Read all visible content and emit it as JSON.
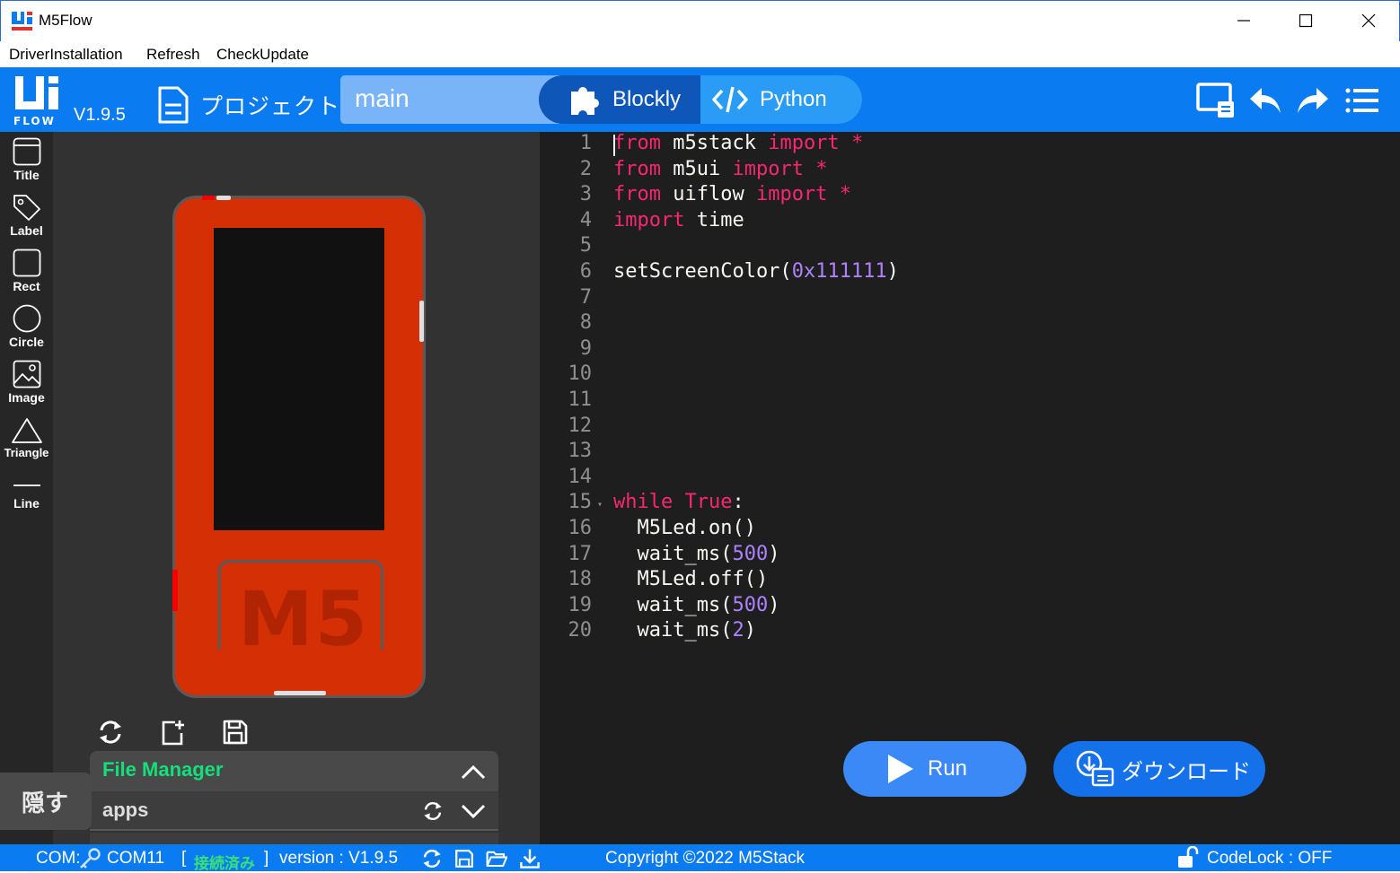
{
  "window": {
    "title": "M5Flow",
    "controls": [
      "minimize-icon",
      "maximize-icon",
      "close-icon"
    ]
  },
  "menu": {
    "items": [
      "DriverInstallation",
      "Refresh",
      "CheckUpdate"
    ]
  },
  "toolbar": {
    "logo_sub": "FLOW",
    "version": "V1.9.5",
    "project_label": "プロジェクト",
    "filename": "main",
    "blockly_label": "Blockly",
    "python_label": "Python",
    "active_mode": "Python",
    "right_icons": [
      "device-screen-icon",
      "undo-icon",
      "redo-icon",
      "menu-icon"
    ]
  },
  "ui_tools": [
    {
      "label": "Title",
      "icon": "title-icon"
    },
    {
      "label": "Label",
      "icon": "label-tag-icon"
    },
    {
      "label": "Rect",
      "icon": "rect-icon"
    },
    {
      "label": "Circle",
      "icon": "circle-icon"
    },
    {
      "label": "Image",
      "icon": "image-icon"
    },
    {
      "label": "Triangle",
      "icon": "triangle-icon"
    },
    {
      "label": "Line",
      "icon": "line-icon"
    }
  ],
  "device": {
    "logo_text": "M5",
    "body_color": "#d42f05",
    "screen_color": "#111111"
  },
  "file_manager": {
    "title": "File Manager",
    "folder": "apps"
  },
  "hide_button": "隠す",
  "editor": {
    "lines": [
      {
        "n": "1",
        "code": "from m5stack import *"
      },
      {
        "n": "2",
        "code": "from m5ui import *"
      },
      {
        "n": "3",
        "code": "from uiflow import *"
      },
      {
        "n": "4",
        "code": "import time"
      },
      {
        "n": "5",
        "code": ""
      },
      {
        "n": "6",
        "code": "setScreenColor(0x111111)"
      },
      {
        "n": "7",
        "code": ""
      },
      {
        "n": "8",
        "code": ""
      },
      {
        "n": "9",
        "code": ""
      },
      {
        "n": "10",
        "code": ""
      },
      {
        "n": "11",
        "code": ""
      },
      {
        "n": "12",
        "code": ""
      },
      {
        "n": "13",
        "code": ""
      },
      {
        "n": "14",
        "code": ""
      },
      {
        "n": "15",
        "code": "while True:"
      },
      {
        "n": "16",
        "code": "  M5Led.on()"
      },
      {
        "n": "17",
        "code": "  wait_ms(500)"
      },
      {
        "n": "18",
        "code": "  M5Led.off()"
      },
      {
        "n": "19",
        "code": "  wait_ms(500)"
      },
      {
        "n": "20",
        "code": "  wait_ms(2)"
      }
    ],
    "run_label": "Run",
    "download_label": "ダウンロード"
  },
  "status": {
    "com_label": "COM:",
    "com_port": "COM11",
    "conn_open": "[",
    "conn_state": "接続済み",
    "conn_close": "]",
    "version_text": "version : V1.9.5",
    "copyright": "Copyright ©2022 M5Stack",
    "codelock": "CodeLock :  OFF"
  },
  "colors": {
    "accent": "#0a7bf0",
    "keyword": "#f92672",
    "number": "#ae81ff",
    "connected": "#39e079",
    "file_manager_title": "#11e07b"
  }
}
